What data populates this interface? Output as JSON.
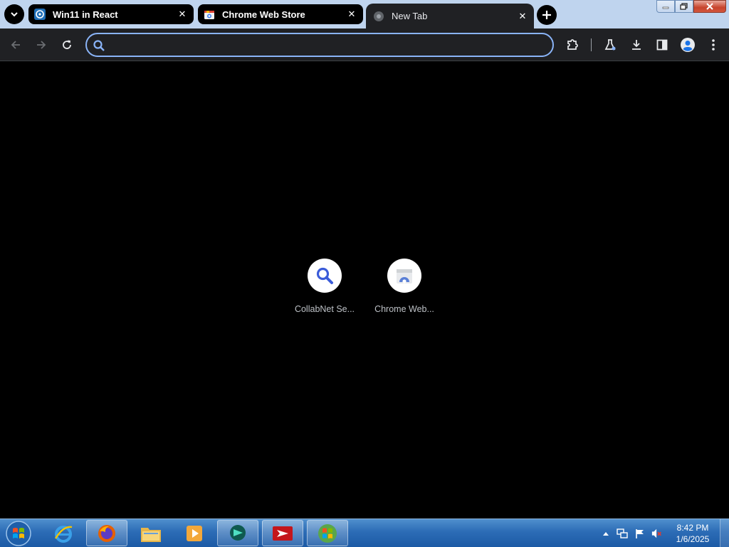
{
  "browser": {
    "tabs": [
      {
        "title": "Win11 in React",
        "favicon": "react-app-icon",
        "active": false
      },
      {
        "title": "Chrome Web Store",
        "favicon": "chrome-web-store-icon",
        "active": false
      },
      {
        "title": "New Tab",
        "favicon": "chrome-globe-icon",
        "active": true
      }
    ],
    "tab_close_glyph": "✕",
    "omnibox": {
      "value": "",
      "placeholder": ""
    },
    "toolbar_icons": [
      "back-icon",
      "forward-icon",
      "reload-icon",
      "extensions-icon",
      "labs-icon",
      "download-icon",
      "side-panel-icon",
      "profile-icon",
      "menu-icon"
    ],
    "accent_color": "#8ab4f8"
  },
  "new_tab": {
    "shortcuts": [
      {
        "label": "CollabNet Se...",
        "icon": "magnifier-icon"
      },
      {
        "label": "Chrome Web...",
        "icon": "chrome-web-store-icon"
      }
    ]
  },
  "taskbar": {
    "pinned": [
      "internet-explorer-icon",
      "firefox-icon",
      "file-explorer-icon",
      "media-player-icon",
      "chat-app-icon",
      "remote-app-icon",
      "windows-logo-icon"
    ],
    "tray_icons": [
      "show-hidden-icons",
      "network-icon",
      "action-center-flag-icon",
      "volume-muted-icon"
    ],
    "clock": {
      "time": "8:42 PM",
      "date": "1/6/2025"
    }
  }
}
